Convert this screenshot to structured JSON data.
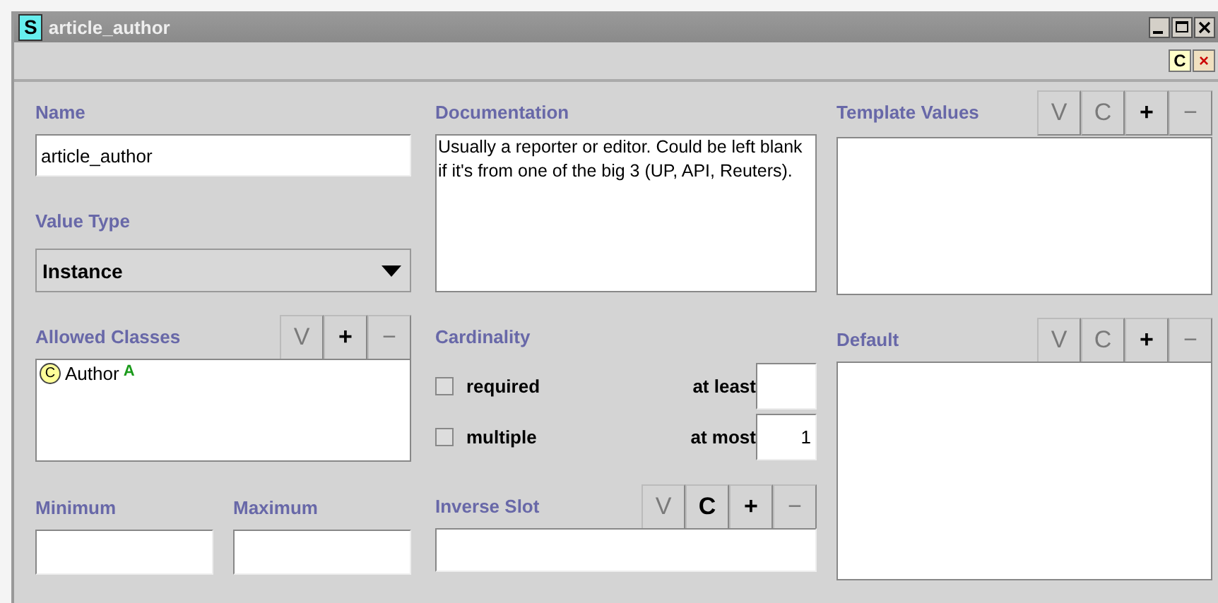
{
  "window": {
    "badge": "S",
    "title": "article_author",
    "header_buttons": [
      {
        "label": "C",
        "kind": "class"
      },
      {
        "label": "×",
        "kind": "close"
      }
    ]
  },
  "name": {
    "label": "Name",
    "value": "article_author"
  },
  "documentation": {
    "label": "Documentation",
    "value": "Usually a reporter or editor. Could be left blank if it's from one of the big 3 (UP, API, Reuters)."
  },
  "template_values": {
    "label": "Template Values",
    "buttons": [
      {
        "label": "V",
        "disabled": true
      },
      {
        "label": "C",
        "disabled": true
      },
      {
        "label": "+",
        "disabled": false
      },
      {
        "label": "−",
        "disabled": true
      }
    ]
  },
  "value_type": {
    "label": "Value Type",
    "value": "Instance"
  },
  "allowed_classes": {
    "label": "Allowed Classes",
    "buttons": [
      {
        "label": "V",
        "disabled": true
      },
      {
        "label": "+",
        "disabled": false
      },
      {
        "label": "−",
        "disabled": true
      }
    ],
    "items": [
      {
        "icon": "C",
        "name": "Author",
        "marker": "A"
      }
    ]
  },
  "cardinality": {
    "label": "Cardinality",
    "rows": [
      {
        "label": "required",
        "checked": false,
        "bound_label": "at least",
        "bound_value": ""
      },
      {
        "label": "multiple",
        "checked": false,
        "bound_label": "at most",
        "bound_value": "1"
      }
    ]
  },
  "default": {
    "label": "Default",
    "buttons": [
      {
        "label": "V",
        "disabled": true
      },
      {
        "label": "C",
        "disabled": true
      },
      {
        "label": "+",
        "disabled": false
      },
      {
        "label": "−",
        "disabled": true
      }
    ]
  },
  "minimum": {
    "label": "Minimum"
  },
  "maximum": {
    "label": "Maximum"
  },
  "inverse_slot": {
    "label": "Inverse Slot",
    "buttons": [
      {
        "label": "V",
        "disabled": true
      },
      {
        "label": "C",
        "disabled": false
      },
      {
        "label": "+",
        "disabled": false
      },
      {
        "label": "−",
        "disabled": true
      }
    ]
  }
}
